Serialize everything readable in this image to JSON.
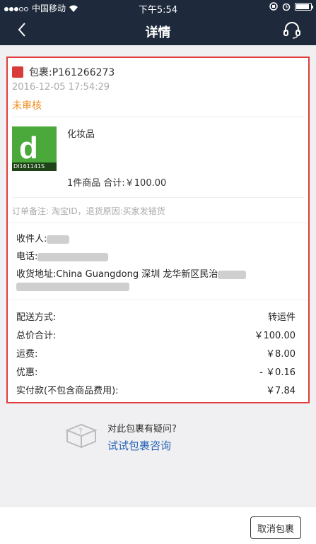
{
  "status_bar": {
    "carrier": "中国移动",
    "time": "下午5:54"
  },
  "nav": {
    "title": "详情"
  },
  "package": {
    "id_label": "包裹:P161266273",
    "date": "2016-12-05 17:54:29",
    "status": "未审核",
    "product_name": "化妆品",
    "product_image_caption": "DI161141S",
    "summary": "1件商品  合计:￥100.00",
    "remark": "订单备注:  淘宝ID，退货原因:买家发错货"
  },
  "receiver": {
    "name_label": "收件人:",
    "phone_label": "电话:",
    "address_label": "收货地址:China Guangdong 深圳 龙华新区民治"
  },
  "fees": [
    {
      "label": "配送方式:",
      "value": "转运件"
    },
    {
      "label": "总价合计:",
      "value": "￥100.00"
    },
    {
      "label": "运费:",
      "value": "￥8.00"
    },
    {
      "label": "优惠:",
      "value": "- ￥0.16"
    },
    {
      "label": "实付款(不包含商品费用):",
      "value": "￥7.84"
    }
  ],
  "help": {
    "question": "对此包裹有疑问?",
    "link": "试试包裹咨询"
  },
  "actions": {
    "cancel": "取消包裹"
  },
  "colors": {
    "nav_bg": "#1e2a3c",
    "highlight_border": "#e23c3c",
    "status_orange": "#f08b1b",
    "link_blue": "#2a64b8"
  }
}
